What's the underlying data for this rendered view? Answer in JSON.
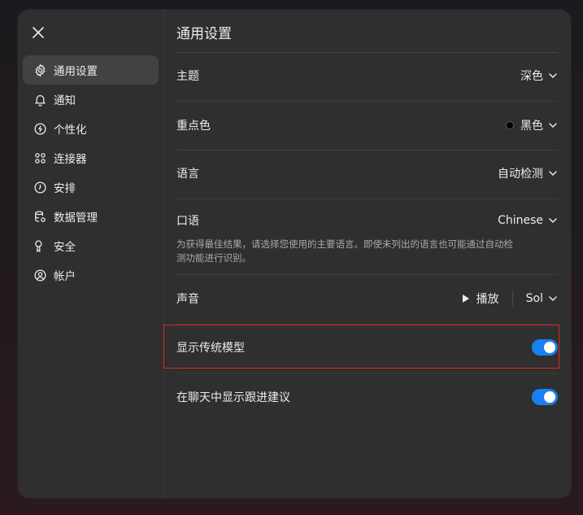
{
  "sidebar": {
    "items": [
      {
        "label": "通用设置",
        "icon": "gear-icon",
        "active": true
      },
      {
        "label": "通知",
        "icon": "bell-icon"
      },
      {
        "label": "个性化",
        "icon": "personalize-icon"
      },
      {
        "label": "连接器",
        "icon": "connectors-icon"
      },
      {
        "label": "安排",
        "icon": "clock-icon"
      },
      {
        "label": "数据管理",
        "icon": "database-icon"
      },
      {
        "label": "安全",
        "icon": "key-icon"
      },
      {
        "label": "帐户",
        "icon": "user-icon"
      }
    ]
  },
  "main": {
    "title": "通用设置",
    "theme": {
      "label": "主题",
      "value": "深色"
    },
    "accent": {
      "label": "重点色",
      "value": "黑色",
      "color": "#000000"
    },
    "language": {
      "label": "语言",
      "value": "自动检测"
    },
    "spoken": {
      "label": "口语",
      "value": "Chinese",
      "description": "为获得最佳结果，请选择您使用的主要语言。即使未列出的语言也可能通过自动检测功能进行识别。"
    },
    "voice": {
      "label": "声音",
      "play_label": "播放",
      "value": "Sol"
    },
    "legacy_models": {
      "label": "显示传统模型",
      "enabled": true
    },
    "follow_ups": {
      "label": "在聊天中显示跟进建议",
      "enabled": true
    }
  },
  "colors": {
    "toggle_on": "#1a7ff0",
    "highlight": "#e0261f"
  }
}
